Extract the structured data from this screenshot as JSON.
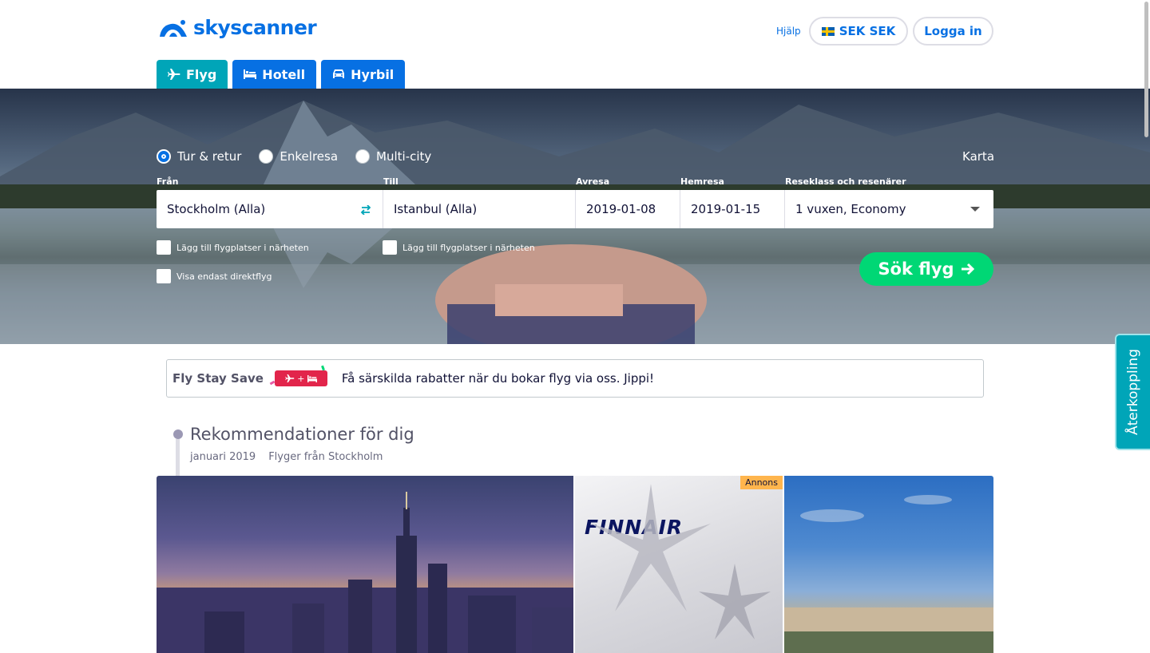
{
  "header": {
    "logo_text": "skyscanner",
    "help_label": "Hjälp",
    "currency_label": "SEK SEK",
    "login_label": "Logga in"
  },
  "tabs": [
    {
      "label": "Flyg",
      "icon": "plane-icon",
      "active": true
    },
    {
      "label": "Hotell",
      "icon": "bed-icon",
      "active": false
    },
    {
      "label": "Hyrbil",
      "icon": "car-icon",
      "active": false
    }
  ],
  "search": {
    "trip_types": [
      {
        "label": "Tur & retur",
        "selected": true
      },
      {
        "label": "Enkelresa",
        "selected": false
      },
      {
        "label": "Multi-city",
        "selected": false
      }
    ],
    "map_label": "Karta",
    "from_label": "Från",
    "from_value": "Stockholm (Alla)",
    "to_label": "Till",
    "to_value": "Istanbul (Alla)",
    "depart_label": "Avresa",
    "depart_value": "2019-01-08",
    "return_label": "Hemresa",
    "return_value": "2019-01-15",
    "class_label": "Reseklass och resenärer",
    "class_value": "1 vuxen, Economy",
    "nearby_from_label": "Lägg till flygplatser i närheten",
    "nearby_to_label": "Lägg till flygplatser i närheten",
    "direct_only_label": "Visa endast direktflyg",
    "search_button_label": "Sök flyg"
  },
  "promo": {
    "brand": "Fly Stay Save",
    "badge_plus": "+",
    "text": "Få särskilda rabatter när du bokar flyg via oss. Jippi!"
  },
  "recommendations": {
    "title": "Rekommendationer för dig",
    "month": "januari 2019",
    "origin": "Flyger från Stockholm",
    "ad_label": "Annons",
    "ad_brand": "FINNAIR"
  },
  "feedback_label": "Återkoppling",
  "colors": {
    "brand_blue": "#0770e3",
    "active_tab": "#00a5b8",
    "search_green": "#00d775",
    "promo_red": "#e2254b",
    "ad_yellow": "#ffb54d"
  }
}
